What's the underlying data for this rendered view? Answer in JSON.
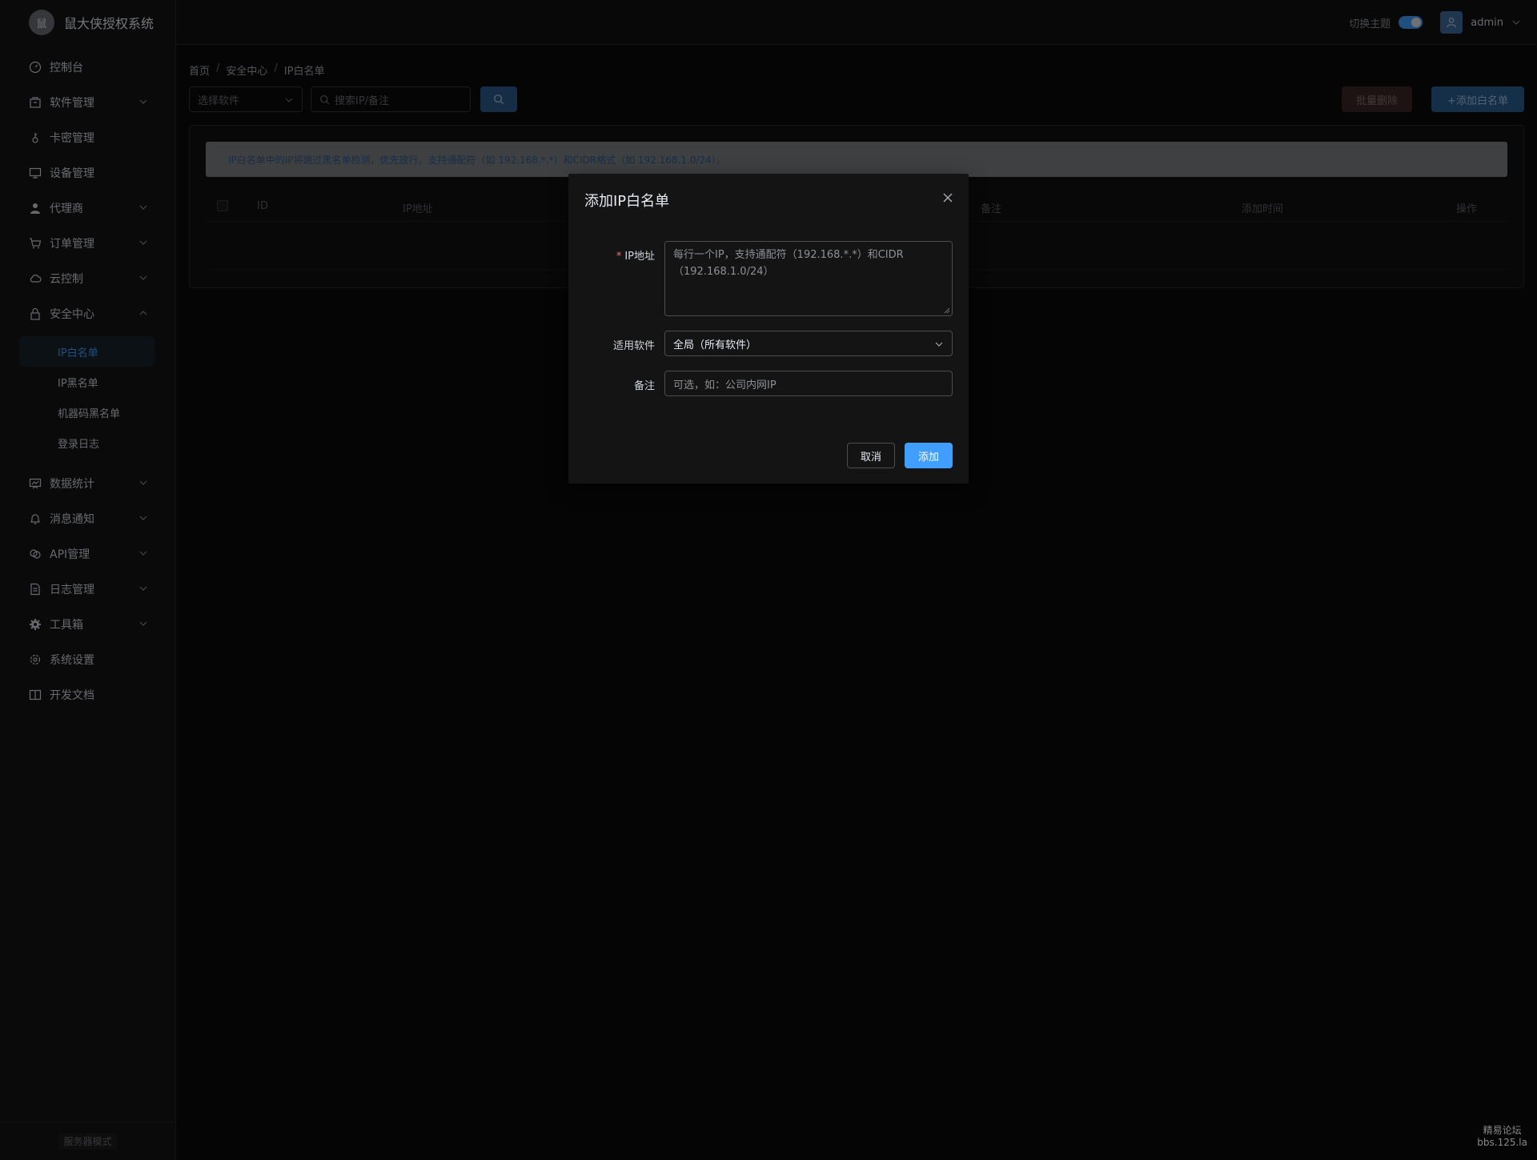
{
  "app": {
    "title": "鼠大侠授权系统",
    "logo_text": "鼠"
  },
  "sidebar": {
    "items": [
      {
        "label": "控制台",
        "icon": "dashboard-icon"
      },
      {
        "label": "软件管理",
        "icon": "package-icon"
      },
      {
        "label": "卡密管理",
        "icon": "key-icon"
      },
      {
        "label": "设备管理",
        "icon": "monitor-icon"
      },
      {
        "label": "代理商",
        "icon": "user-icon"
      },
      {
        "label": "订单管理",
        "icon": "cart-icon"
      },
      {
        "label": "云控制",
        "icon": "cloud-icon"
      },
      {
        "label": "安全中心",
        "icon": "lock-icon"
      },
      {
        "label": "数据统计",
        "icon": "chart-icon"
      },
      {
        "label": "消息通知",
        "icon": "bell-icon"
      },
      {
        "label": "API管理",
        "icon": "link-icon"
      },
      {
        "label": "日志管理",
        "icon": "document-icon"
      },
      {
        "label": "工具箱",
        "icon": "gear-icon"
      },
      {
        "label": "系统设置",
        "icon": "settings-icon"
      },
      {
        "label": "开发文档",
        "icon": "book-icon"
      }
    ],
    "security_sub": [
      "IP白名单",
      "IP黑名单",
      "机器码黑名单",
      "登录日志"
    ],
    "footer_mode": "服务器模式"
  },
  "header": {
    "theme_label": "切换主题",
    "user": "admin"
  },
  "breadcrumb": [
    "首页",
    "安全中心",
    "IP白名单"
  ],
  "toolbar": {
    "software_placeholder": "选择软件",
    "search_placeholder": "搜索IP/备注",
    "batch_delete": "批量删除",
    "add_whitelist": "+添加白名单"
  },
  "alert": "IP白名单中的IP将跳过黑名单检测，优先放行。支持通配符（如 192.168.*.*）和CIDR格式（如 192.168.1.0/24）。",
  "table": {
    "columns": [
      "ID",
      "IP地址",
      "备注",
      "添加时间",
      "操作"
    ]
  },
  "dialog": {
    "title": "添加IP白名单",
    "ip_label": "IP地址",
    "ip_placeholder": "每行一个IP，支持通配符（192.168.*.*）和CIDR（192.168.1.0/24）",
    "software_label": "适用软件",
    "software_value": "全局（所有软件）",
    "remark_label": "备注",
    "remark_placeholder": "可选，如：公司内网IP",
    "cancel": "取消",
    "confirm": "添加"
  },
  "watermark": [
    "精易论坛",
    "bbs.125.la"
  ],
  "colors": {
    "primary": "#409eff",
    "danger": "#f56c6c",
    "bg": "#0b0b0b"
  }
}
